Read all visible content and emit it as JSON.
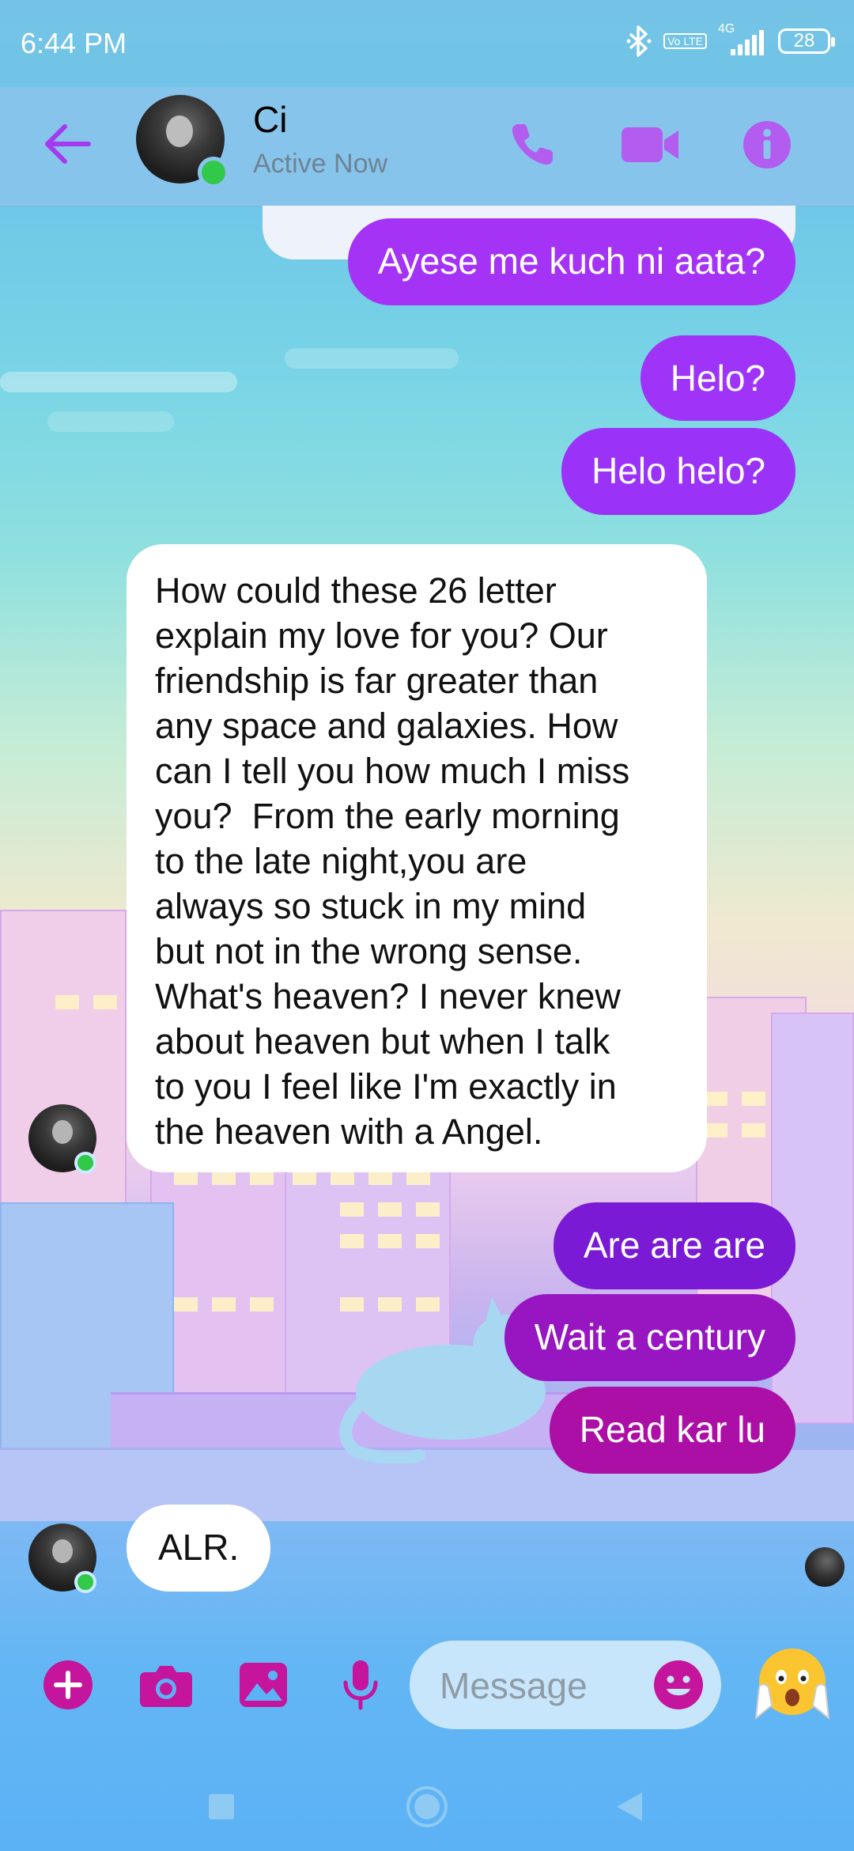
{
  "status_bar": {
    "time": "6:44 PM",
    "network_lte": "Vo LTE",
    "network_gen": "4G",
    "battery": "28",
    "icons": [
      "bluetooth-icon",
      "volte-icon",
      "signal-icon",
      "battery-icon"
    ]
  },
  "header": {
    "contact_name": "Ci",
    "contact_status": "Active Now",
    "icons": [
      "back-arrow-icon",
      "phone-icon",
      "video-camera-icon",
      "info-icon"
    ]
  },
  "colors": {
    "accent": "#a33af0",
    "header_icon": "#b25cf0",
    "composer_icon": "#c4159c",
    "online": "#31c94a",
    "out_bubble_top": "#a333f6",
    "out_bubble_bottom": "#b010a2"
  },
  "messages": [
    {
      "from": "me",
      "text": "Ayese me kuch ni aata?"
    },
    {
      "from": "me",
      "text": "Helo?"
    },
    {
      "from": "me",
      "text": "Helo helo?"
    },
    {
      "from": "contact",
      "lines": [
        "How could these 26 letter",
        "explain my love for you? Our",
        "friendship is far greater than",
        "any space and galaxies. How",
        "can I tell you how much I miss",
        "you?  From the early morning",
        "to the late night,you are",
        "always so stuck in my mind",
        "but not in the wrong sense.",
        "What's heaven? I never knew",
        "about heaven but when I talk",
        "to you I feel like I'm exactly in",
        "the heaven with a Angel."
      ]
    },
    {
      "from": "me",
      "text": "Are are are"
    },
    {
      "from": "me",
      "text": "Wait a century"
    },
    {
      "from": "me",
      "text": "Read kar lu"
    },
    {
      "from": "contact",
      "text": "ALR."
    }
  ],
  "composer": {
    "placeholder": "Message",
    "icons": [
      "plus-icon",
      "camera-icon",
      "image-icon",
      "microphone-icon",
      "smiley-icon",
      "shocked-face-emoji-icon"
    ]
  },
  "nav": {
    "icons": [
      "recents-square-icon",
      "home-circle-icon",
      "back-triangle-icon"
    ]
  }
}
